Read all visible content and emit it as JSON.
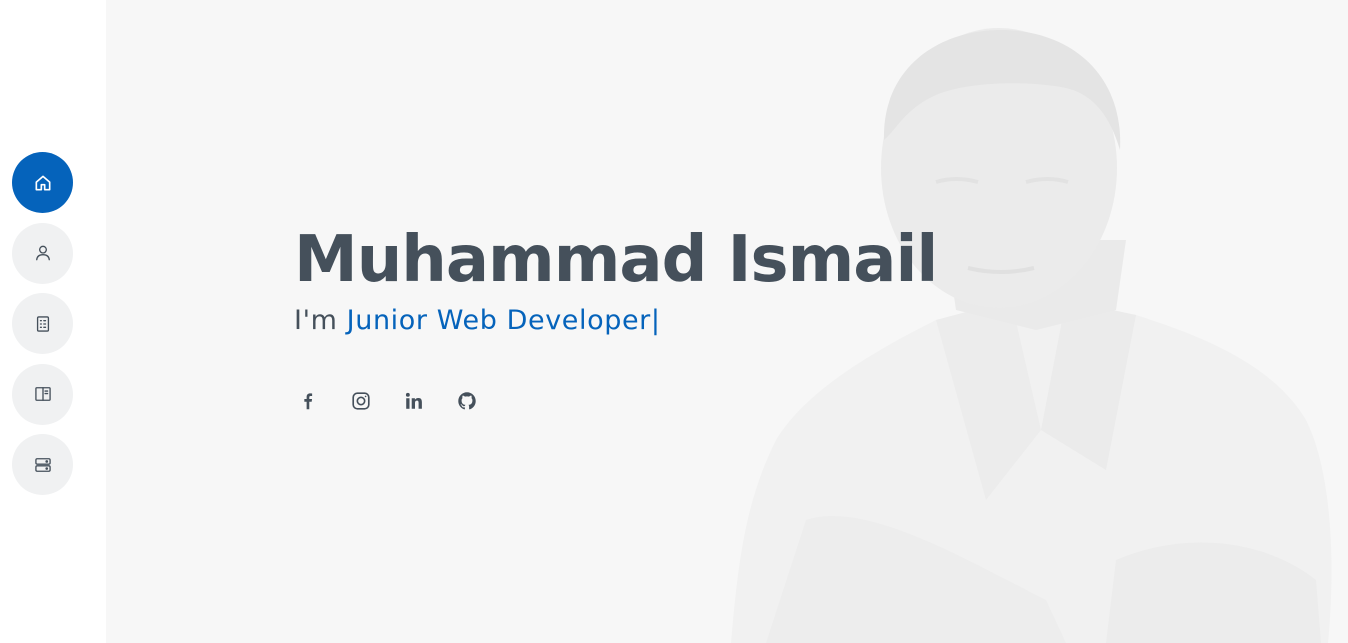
{
  "nav": {
    "items": [
      {
        "icon": "home-icon",
        "active": true
      },
      {
        "icon": "user-icon",
        "active": false
      },
      {
        "icon": "file-text-icon",
        "active": false
      },
      {
        "icon": "book-icon",
        "active": false
      },
      {
        "icon": "server-icon",
        "active": false
      }
    ]
  },
  "hero": {
    "name": "Muhammad Ismail",
    "prefix": "I'm ",
    "role": "Junior Web Developer",
    "cursor": "|"
  },
  "social": [
    "facebook-icon",
    "instagram-icon",
    "linkedin-icon",
    "github-icon"
  ],
  "colors": {
    "accent": "#0563bb",
    "text": "#45505b",
    "background": "#f7f7f7",
    "nav_button": "#f0f1f2"
  }
}
